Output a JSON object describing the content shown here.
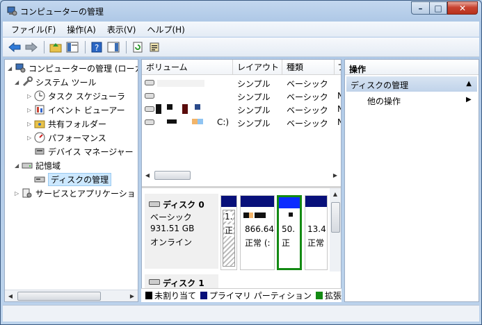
{
  "window": {
    "title": "コンピューターの管理"
  },
  "menu": [
    "ファイル(F)",
    "操作(A)",
    "表示(V)",
    "ヘルプ(H)"
  ],
  "tree": {
    "root": "コンピューターの管理 (ローカ",
    "system_tools": "システム ツール",
    "task_scheduler": "タスク スケジューラ",
    "event_viewer": "イベント ビューアー",
    "shared_folders": "共有フォルダー",
    "performance": "パフォーマンス",
    "device_manager": "デバイス マネージャー",
    "storage": "記憶域",
    "disk_management": "ディスクの管理",
    "services_apps": "サービスとアプリケーショ"
  },
  "volume_list": {
    "columns": [
      "ボリューム",
      "レイアウト",
      "種類",
      "フ"
    ],
    "rows": [
      {
        "volume": "",
        "layout": "シンプル",
        "type": "ベーシック",
        "fs": ""
      },
      {
        "volume": "",
        "layout": "シンプル",
        "type": "ベーシック",
        "fs": "N"
      },
      {
        "volume": "",
        "layout": "シンプル",
        "type": "ベーシック",
        "fs": "N"
      },
      {
        "volume": "C:)",
        "layout": "シンプル",
        "type": "ベーシック",
        "fs": "N"
      }
    ]
  },
  "disk0": {
    "name": "ディスク 0",
    "type": "ベーシック",
    "size": "931.51 GB",
    "status": "オンライン",
    "partitions": [
      {
        "size": "1.",
        "status": "正"
      },
      {
        "size": "866.64",
        "status": "正常 (:"
      },
      {
        "size": "50.",
        "status": "正"
      },
      {
        "size": "13.4",
        "status": "正常"
      }
    ]
  },
  "disk1": {
    "name": "ディスク 1"
  },
  "legend": [
    "未割り当て",
    "プライマリ パーティション",
    "拡張"
  ],
  "actions": {
    "header": "操作",
    "section": "ディスクの管理",
    "item": "他の操作"
  },
  "colors": {
    "unallocated": "#000000",
    "primary": "#08107a",
    "extended": "#138a13",
    "selected_bar": "#0c2cff"
  }
}
